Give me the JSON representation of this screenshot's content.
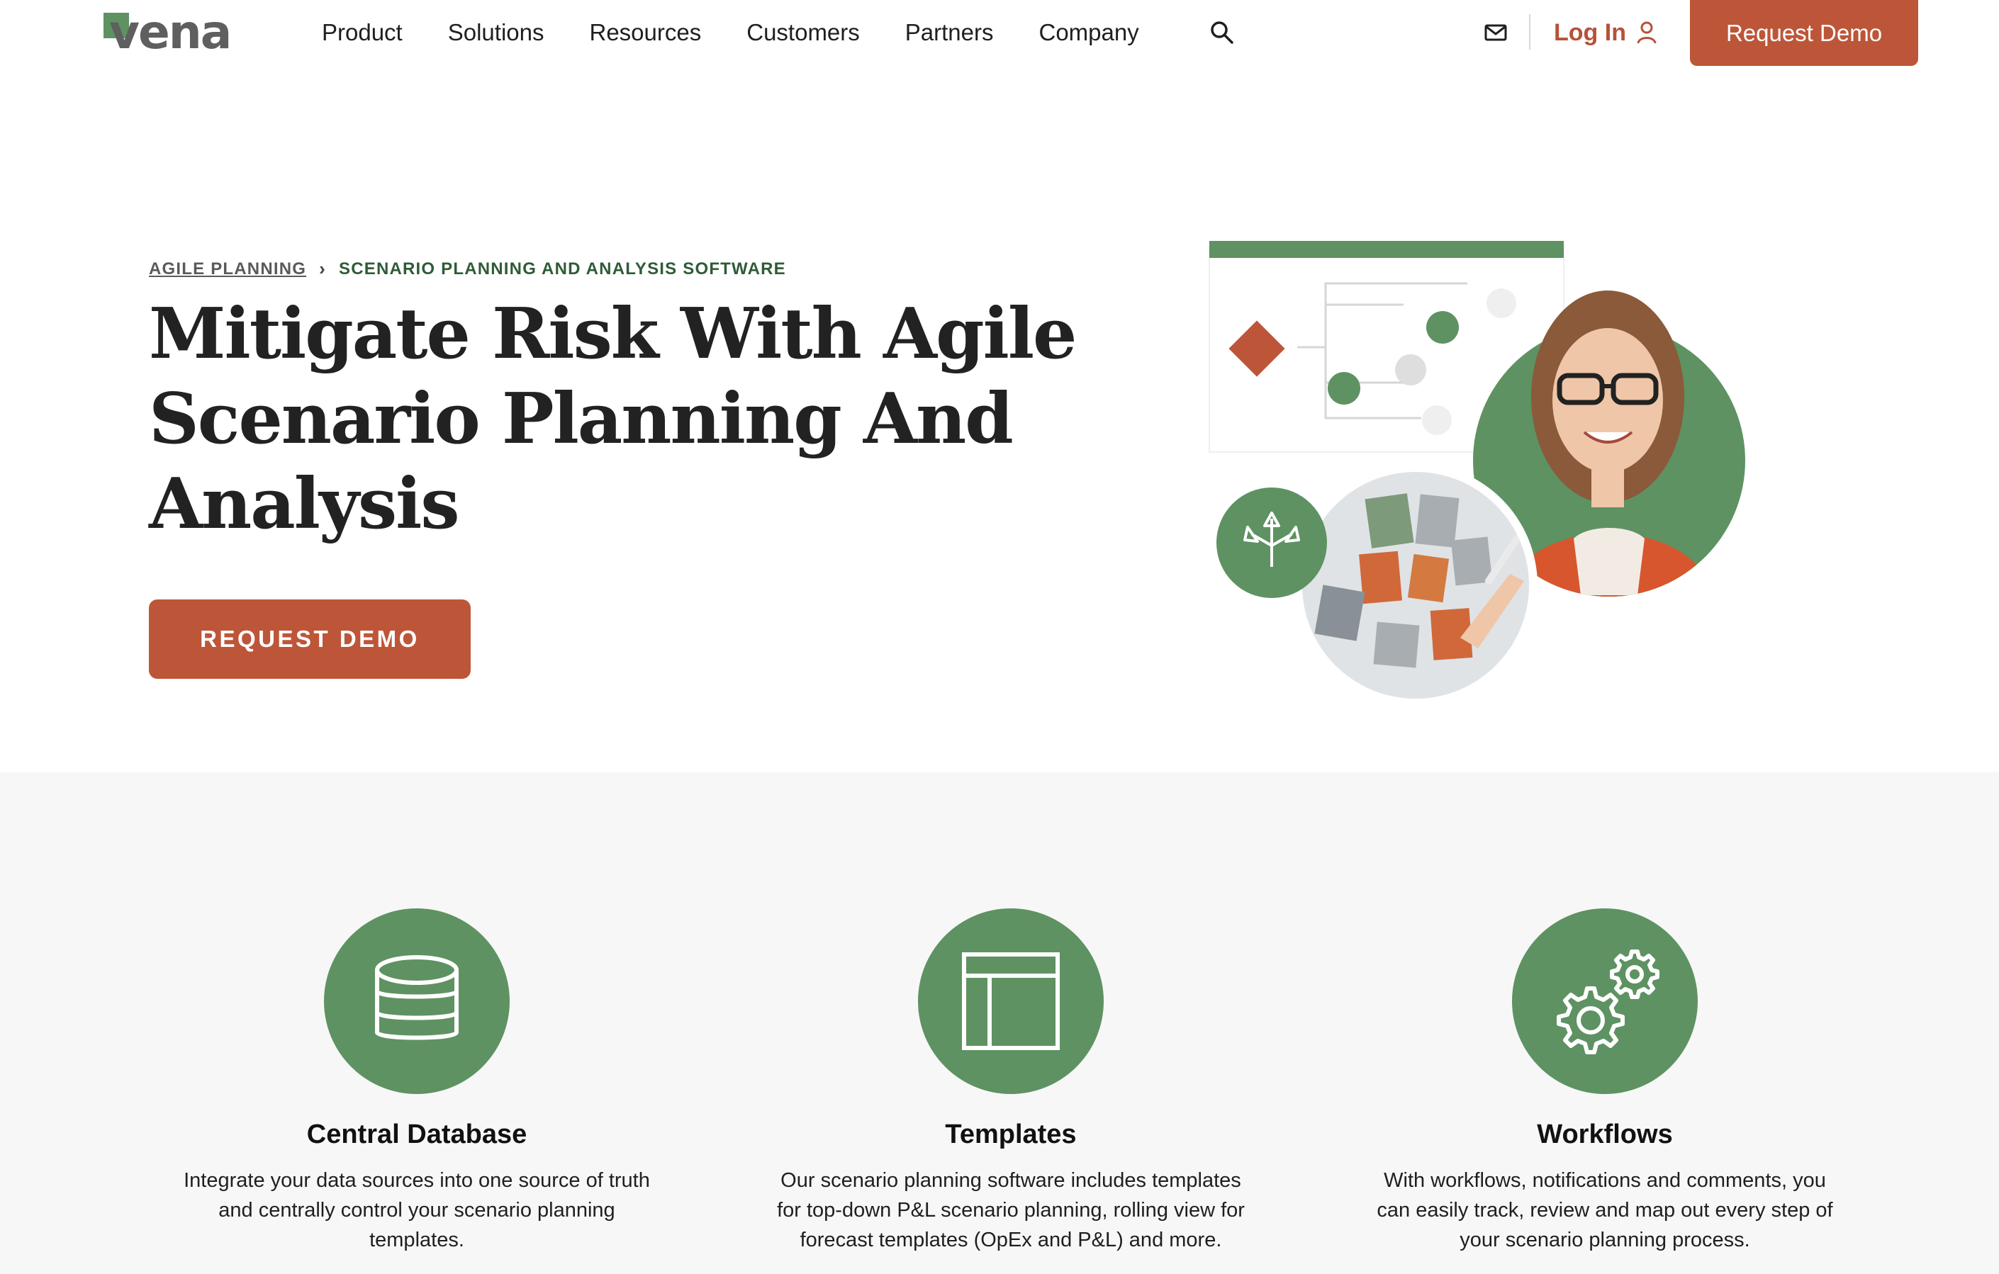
{
  "header": {
    "logo_text": "vena",
    "nav": [
      "Product",
      "Solutions",
      "Resources",
      "Customers",
      "Partners",
      "Company"
    ],
    "login_label": "Log In",
    "cta_label": "Request Demo",
    "icons": {
      "search": "search-icon",
      "mail": "mail-icon",
      "user": "user-icon"
    },
    "colors": {
      "brand_green": "#5e9262",
      "cta": "#bd5638",
      "login": "#b7513a"
    }
  },
  "hero": {
    "breadcrumb": {
      "parent": "AGILE PLANNING",
      "current": "SCENARIO PLANNING AND ANALYSIS SOFTWARE"
    },
    "title_lines": [
      "Mitigate Risk With Agile",
      "Scenario Planning And",
      "Analysis"
    ],
    "cta_label": "REQUEST DEMO"
  },
  "features": [
    {
      "icon": "database-icon",
      "title": "Central Database",
      "text": "Integrate your data sources into one source of truth and centrally control your scenario planning templates."
    },
    {
      "icon": "template-layout-icon",
      "title": "Templates",
      "text": "Our scenario planning software includes templates for top-down P&L scenario planning, rolling view for forecast templates (OpEx and P&L) and more."
    },
    {
      "icon": "gears-icon",
      "title": "Workflows",
      "text": "With workflows, notifications and comments, you can easily track, review and map out every step of your scenario planning process."
    }
  ]
}
